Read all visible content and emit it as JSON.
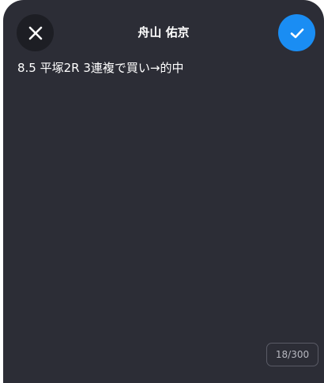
{
  "header": {
    "title": "舟山 佑京"
  },
  "memo": {
    "text": "8.5 平塚2R 3連複で買い→的中"
  },
  "counter": {
    "text": "18/300"
  },
  "colors": {
    "background": "#2c2d36",
    "close_button": "#1d1e24",
    "confirm_button": "#1a8df3"
  },
  "icons": {
    "close": "close-icon",
    "confirm": "check-icon"
  }
}
